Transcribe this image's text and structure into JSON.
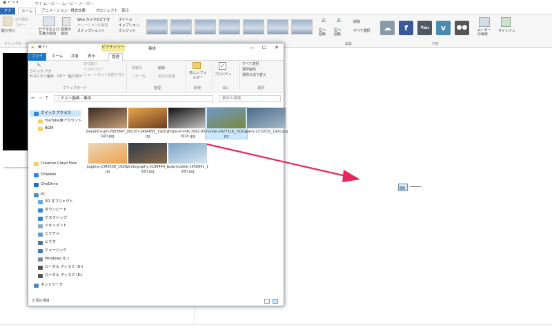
{
  "moviemaker": {
    "title": "マイ ムービー - ムービー メーカー",
    "tabs": [
      "ファイル",
      "ホーム",
      "アニメーション",
      "視覚効果",
      "プロジェクト",
      "表示"
    ],
    "ribbon": {
      "paste": "貼り付け",
      "cut": "切り取り",
      "copy": "コピー",
      "clipboard_label": "クリップボード",
      "add_video": "ビデオおよび写真の追加",
      "add_music": "音楽の追加",
      "webcam": "Web カメラのビデオ",
      "narration": "ナレーションの録音",
      "snapshot": "スナップショット",
      "title": "タイトル",
      "caption": "キャプション",
      "credits": "クレジット",
      "rotate_left": "左へ回転",
      "rotate_right": "右へ回転",
      "remove": "削除",
      "select_all": "すべて選択",
      "edit_label": "編集",
      "share_label": "共有",
      "save_movie": "ムービーの保存",
      "sign_in": "サインイン"
    },
    "share_services": [
      "OneDrive",
      "Facebook",
      "YouTube",
      "Vimeo",
      "Flickr"
    ]
  },
  "explorer": {
    "context_header": "ピクチャツール",
    "folder_name": "素体",
    "tabs": [
      "ファイル",
      "ホーム",
      "共有",
      "表示",
      "管理"
    ],
    "ribbon": {
      "pin_quick": "クイック アクセスにピン留め",
      "copy": "コピー",
      "paste": "貼り付け",
      "cut": "切り取り",
      "copy_path": "パスのコピー",
      "paste_shortcut": "ショートカットの貼り付け",
      "clipboard_label": "クリップボード",
      "move_to": "移動先",
      "copy_to": "コピー先",
      "delete": "削除",
      "rename": "名前の変更",
      "organize_label": "整理",
      "new_folder": "新しいフォルダー",
      "new_label": "新規",
      "properties": "プロパティ",
      "open_label": "開く",
      "select_all": "すべて選択",
      "select_none": "選択解除",
      "invert_selection": "選択の切り替え",
      "select_label": "選択"
    },
    "address": "› テスト動画 › 素体",
    "search_placeholder": "素体の検索",
    "nav": [
      "クイック アクセス",
      "YouTube用アカウント",
      "BGM",
      "Creative Cloud Files",
      "Dropbox",
      "OneDrive",
      "PC",
      "3D オブジェクト",
      "ダウンロード",
      "デスクトップ",
      "ドキュメント",
      "ピクチャ",
      "ビデオ",
      "ミュージック",
      "Windows (C:)",
      "ローカル ディスク (D:)",
      "ローカル ディスク (E:)",
      "ネットワーク"
    ],
    "files": [
      {
        "name": "beautiful-girl-2003647_1920.jpg",
        "colors": [
          "#3b2a22",
          "#c9a27a"
        ]
      },
      {
        "name": "church-2464895_1920.jpg",
        "colors": [
          "#e7a84a",
          "#6f3d1e"
        ]
      },
      {
        "name": "drops-of-milk-2062100_1920.jpg",
        "colors": [
          "#111111",
          "#c8c8c8"
        ]
      },
      {
        "name": "hunter-2427518_1920.jpg",
        "colors": [
          "#6f98c9",
          "#7a8a3c"
        ]
      },
      {
        "name": "jeans-2172032_1920.jpg",
        "colors": [
          "#4a6a8a",
          "#a7b8c8"
        ]
      },
      {
        "name": "jogging-2343558_1920.jpg",
        "colors": [
          "#e8d9b8",
          "#f0a050"
        ]
      },
      {
        "name": "photography-2188440_1920.jpg",
        "colors": [
          "#2f3c4a",
          "#8a6a4a"
        ]
      },
      {
        "name": "soap-bubble-1958841_1920.jpg",
        "colors": [
          "#7aa4c6",
          "#d8e6ef"
        ]
      }
    ],
    "status": "8 個の項目"
  },
  "colors": {
    "accent": "#1979ca",
    "arrow": "#e8245c",
    "selection": "#cce8ff"
  }
}
